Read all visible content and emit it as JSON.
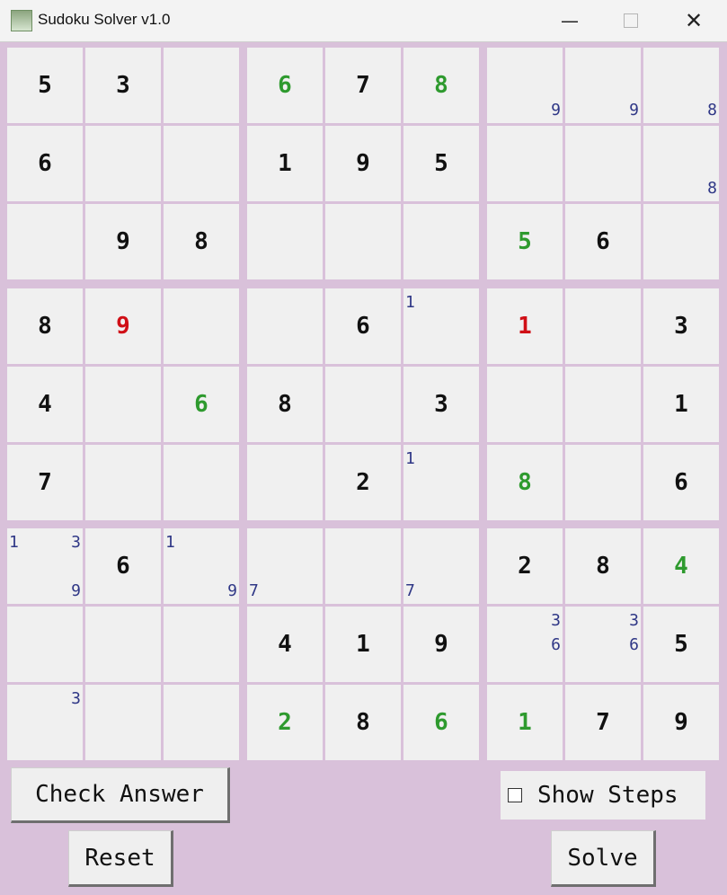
{
  "window": {
    "title": "Sudoku Solver v1.0",
    "minimize": "—",
    "close": "✕"
  },
  "grid": [
    [
      {
        "v": "5",
        "c": "black"
      },
      {
        "v": "3",
        "c": "black"
      },
      {
        "v": ""
      },
      {
        "v": "6",
        "c": "green"
      },
      {
        "v": "7",
        "c": "black"
      },
      {
        "v": "8",
        "c": "green"
      },
      {
        "v": "",
        "n": [
          "9"
        ]
      },
      {
        "v": "",
        "n": [
          "9"
        ]
      },
      {
        "v": "",
        "n": [
          "8"
        ]
      }
    ],
    [
      {
        "v": "6",
        "c": "black"
      },
      {
        "v": ""
      },
      {
        "v": ""
      },
      {
        "v": "1",
        "c": "black"
      },
      {
        "v": "9",
        "c": "black"
      },
      {
        "v": "5",
        "c": "black"
      },
      {
        "v": ""
      },
      {
        "v": ""
      },
      {
        "v": "",
        "n": [
          "8"
        ]
      }
    ],
    [
      {
        "v": ""
      },
      {
        "v": "9",
        "c": "black"
      },
      {
        "v": "8",
        "c": "black"
      },
      {
        "v": ""
      },
      {
        "v": ""
      },
      {
        "v": ""
      },
      {
        "v": "5",
        "c": "green"
      },
      {
        "v": "6",
        "c": "black"
      },
      {
        "v": ""
      }
    ],
    [
      {
        "v": "8",
        "c": "black"
      },
      {
        "v": "9",
        "c": "red"
      },
      {
        "v": ""
      },
      {
        "v": ""
      },
      {
        "v": "6",
        "c": "black"
      },
      {
        "v": "",
        "n": [
          "1"
        ]
      },
      {
        "v": "1",
        "c": "red"
      },
      {
        "v": ""
      },
      {
        "v": "3",
        "c": "black"
      }
    ],
    [
      {
        "v": "4",
        "c": "black"
      },
      {
        "v": ""
      },
      {
        "v": "6",
        "c": "green"
      },
      {
        "v": "8",
        "c": "black"
      },
      {
        "v": ""
      },
      {
        "v": "3",
        "c": "black"
      },
      {
        "v": ""
      },
      {
        "v": ""
      },
      {
        "v": "1",
        "c": "black"
      }
    ],
    [
      {
        "v": "7",
        "c": "black"
      },
      {
        "v": ""
      },
      {
        "v": ""
      },
      {
        "v": ""
      },
      {
        "v": "2",
        "c": "black"
      },
      {
        "v": "",
        "n": [
          "1"
        ]
      },
      {
        "v": "8",
        "c": "green"
      },
      {
        "v": ""
      },
      {
        "v": "6",
        "c": "black"
      }
    ],
    [
      {
        "v": "",
        "n": [
          "1",
          "3",
          "9"
        ]
      },
      {
        "v": "6",
        "c": "black"
      },
      {
        "v": "",
        "n": [
          "1",
          "9"
        ]
      },
      {
        "v": "",
        "n": [
          "7"
        ]
      },
      {
        "v": ""
      },
      {
        "v": "",
        "n": [
          "7"
        ]
      },
      {
        "v": "2",
        "c": "black"
      },
      {
        "v": "8",
        "c": "black"
      },
      {
        "v": "4",
        "c": "green"
      }
    ],
    [
      {
        "v": ""
      },
      {
        "v": ""
      },
      {
        "v": ""
      },
      {
        "v": "4",
        "c": "black"
      },
      {
        "v": "1",
        "c": "black"
      },
      {
        "v": "9",
        "c": "black"
      },
      {
        "v": "",
        "n": [
          "3",
          "6"
        ]
      },
      {
        "v": "",
        "n": [
          "3",
          "6"
        ]
      },
      {
        "v": "5",
        "c": "black"
      }
    ],
    [
      {
        "v": "",
        "n": [
          "3"
        ]
      },
      {
        "v": ""
      },
      {
        "v": ""
      },
      {
        "v": "2",
        "c": "green"
      },
      {
        "v": "8",
        "c": "black"
      },
      {
        "v": "6",
        "c": "green"
      },
      {
        "v": "1",
        "c": "green"
      },
      {
        "v": "7",
        "c": "black"
      },
      {
        "v": "9",
        "c": "black"
      }
    ]
  ],
  "controls": {
    "check_answer": "Check Answer",
    "reset": "Reset",
    "show_steps": "Show Steps",
    "solve": "Solve",
    "show_steps_checked": false
  },
  "colors": {
    "background": "#d9c1da",
    "cell": "#f0f0f0",
    "given": "#111111",
    "correct": "#2e9a2e",
    "wrong": "#d00f16",
    "note": "#2f3786"
  }
}
